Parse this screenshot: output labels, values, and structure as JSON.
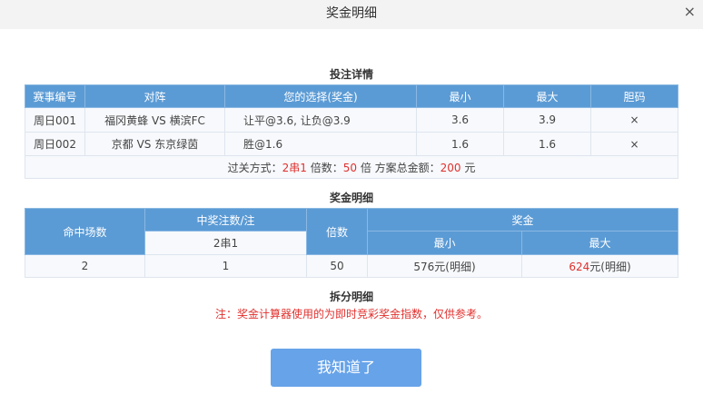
{
  "dialog": {
    "title": "奖金明细",
    "close": "×",
    "button": "我知道了"
  },
  "bet": {
    "title": "投注详情",
    "headers": [
      "赛事编号",
      "对阵",
      "您的选择(奖金)",
      "最小",
      "最大",
      "胆码"
    ],
    "rows": [
      [
        "周日001",
        "福冈黄蜂 VS 横滨FC",
        "让平@3.6, 让负@3.9",
        "3.6",
        "3.9",
        "×"
      ],
      [
        "周日002",
        "京都 VS 东京绿茵",
        "胜@1.6",
        "1.6",
        "1.6",
        "×"
      ]
    ],
    "summary": {
      "l1": "过关方式：",
      "v1": "2串1",
      "l2": " 倍数：",
      "v2": "50",
      "l3": " 倍 方案总金额：",
      "v3": "200",
      "l4": " 元"
    }
  },
  "prize": {
    "title": "奖金明细",
    "h_hits": "命中场数",
    "h_count": "中奖注数/注",
    "h_type": "2串1",
    "h_mult": "倍数",
    "h_prize": "奖金",
    "h_min": "最小",
    "h_max": "最大",
    "row": {
      "hits": "2",
      "count": "1",
      "mult": "50",
      "min": "576元(明细)",
      "max_val": "624",
      "max_suffix": "元(明细)"
    }
  },
  "split": {
    "title": "拆分明细",
    "note": "注：奖金计算器使用的为即时竞彩奖金指数，仅供参考。"
  }
}
